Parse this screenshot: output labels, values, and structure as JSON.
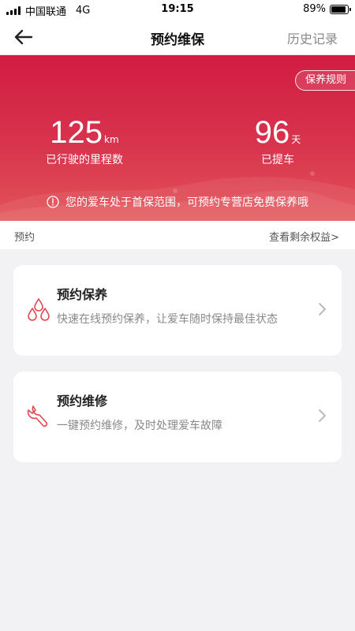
{
  "status_bar": {
    "carrier": "中国联通",
    "network": "4G",
    "time": "19:15",
    "battery_text": "89%",
    "battery_level": 0.89
  },
  "nav": {
    "title": "预约维保",
    "history_label": "历史记录",
    "back_icon": "arrow-left-icon"
  },
  "hero": {
    "rules_label": "保养规则",
    "mileage_value": "125",
    "mileage_unit": "km",
    "mileage_label": "已行驶的里程数",
    "days_value": "96",
    "days_unit": "天",
    "days_label": "已提车",
    "notice_text": "您的爱车处于首保范围，可预约专营店免费保养哦",
    "notice_icon": "exclamation-circle-icon",
    "gradient_top": "#d21c42",
    "gradient_bottom": "#e25457"
  },
  "section": {
    "label": "预约",
    "rights_link": "查看剩余权益>"
  },
  "cards": [
    {
      "title": "预约保养",
      "description": "快速在线预约保养，让爱车随时保持最佳状态",
      "icon": "oil-drops-icon"
    },
    {
      "title": "预约维修",
      "description": "一键预约维修，及时处理爱车故障",
      "icon": "wrench-icon"
    }
  ],
  "colors": {
    "accent": "#d82a46",
    "icon_red": "#e0484f",
    "background": "#f2f2f4"
  }
}
